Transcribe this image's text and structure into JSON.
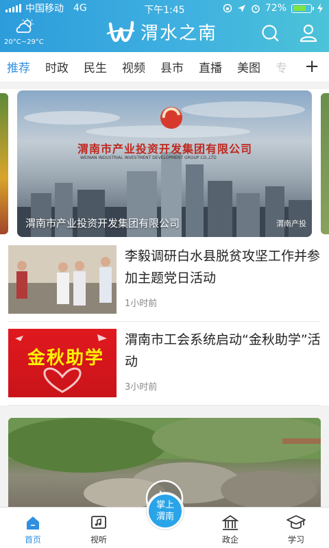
{
  "status_bar": {
    "carrier": "中国移动",
    "network": "4G",
    "time": "下午1:45",
    "battery_percent": "72%",
    "battery_level": 0.72
  },
  "header": {
    "weather_icon": "partly-cloudy-icon",
    "temperature": "20°C~29°C",
    "app_name": "渭水之南",
    "search_icon": "search-icon",
    "user_icon": "user-icon"
  },
  "tabs": [
    {
      "label": "推荐",
      "active": true
    },
    {
      "label": "时政"
    },
    {
      "label": "民生"
    },
    {
      "label": "视频"
    },
    {
      "label": "县市"
    },
    {
      "label": "直播"
    },
    {
      "label": "美图"
    },
    {
      "label": "专"
    }
  ],
  "tab_add": "+",
  "carousel": {
    "logo_text": "渭南市产业投资开发集团有限公司",
    "logo_subtext": "WEINAN INDUSTRIAL INVESTMENT DEVELOPMENT GROUP CO.,LTD",
    "caption": "渭南市产业投资开发集团有限公司",
    "watermark": "渭南产投"
  },
  "news": [
    {
      "title": "李毅调研白水县脱贫攻坚工作并参加主题党日活动",
      "time": "1小时前"
    },
    {
      "title": "渭南市工会系统启动“金秋助学”活动",
      "time": "3小时前",
      "thumb_text": "金秋助学"
    }
  ],
  "bottom_nav": {
    "items": [
      {
        "label": "首页",
        "icon": "home-icon",
        "active": true
      },
      {
        "label": "视听",
        "icon": "media-icon"
      },
      {
        "label": "政企",
        "icon": "government-building-icon"
      },
      {
        "label": "学习",
        "icon": "graduation-cap-icon"
      }
    ],
    "center": {
      "line1": "掌上",
      "line2": "渭南"
    }
  },
  "colors": {
    "accent": "#2f8fe0",
    "header_start": "#2d9cdb",
    "header_end": "#4cc3d8"
  }
}
